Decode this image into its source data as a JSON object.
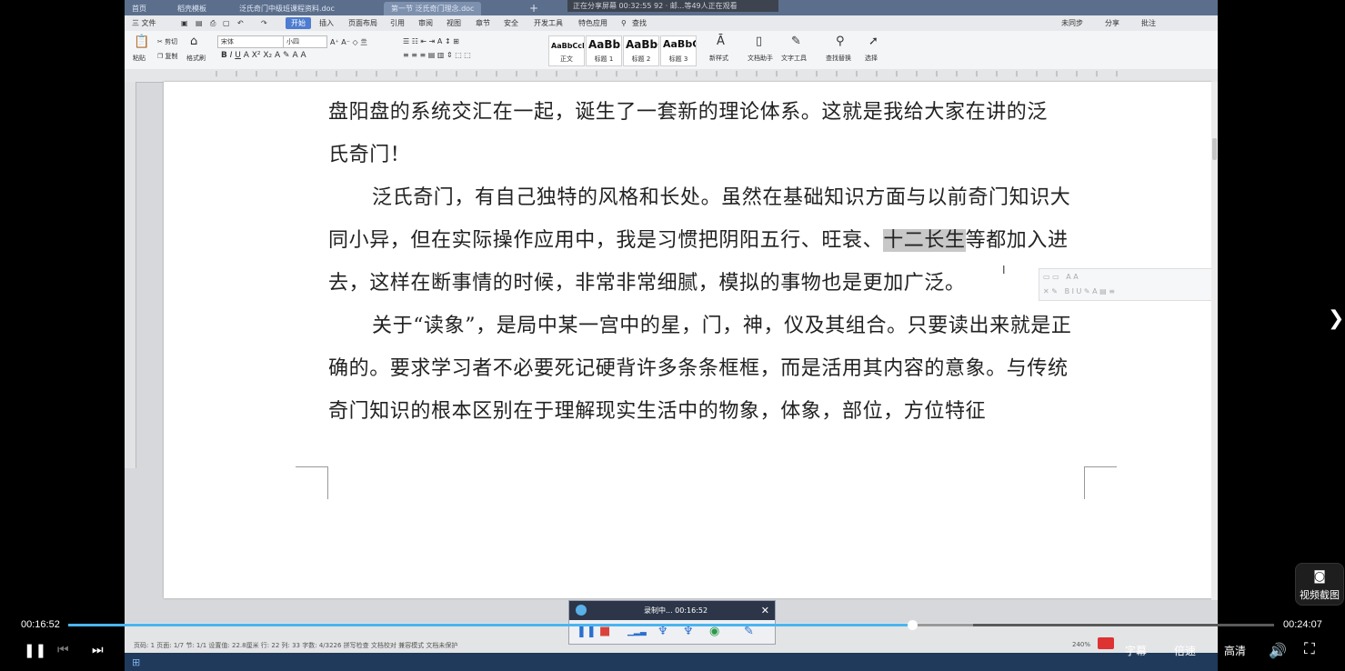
{
  "doc_tabs": [
    "首页",
    "稻壳模板",
    "泛氏奇门中级班课程资料.doc",
    "第一节 泛氏奇门理念.doc"
  ],
  "share_status": "正在分享屏幕    00:32:55    92 · 邮...等49人正在观看",
  "menu": {
    "file": "三 文件",
    "items": [
      "开始",
      "插入",
      "页面布局",
      "引用",
      "审阅",
      "视图",
      "章节",
      "安全",
      "开发工具",
      "特色应用"
    ],
    "search": "查找",
    "right": [
      "未同步",
      "分享",
      "批注"
    ]
  },
  "ribbon": {
    "paste": "粘贴",
    "cut": "剪切",
    "copy": "复制",
    "format_painter": "格式刷",
    "font_name": "宋体",
    "font_size": "小四",
    "styles": [
      {
        "sample": "AaBbCcDd",
        "name": "正文"
      },
      {
        "sample": "AaBb",
        "name": "标题 1"
      },
      {
        "sample": "AaBbC",
        "name": "标题 2"
      },
      {
        "sample": "AaBbC",
        "name": "标题 3"
      }
    ],
    "new_style": "新样式",
    "doc_assistant": "文档助手",
    "text_tools": "文字工具",
    "find_replace": "查找替换",
    "select": "选择"
  },
  "document": {
    "line1": "盘阳盘的系统交汇在一起，诞生了一套新的理论体系。这就是我给大家在讲的泛",
    "line2": "氏奇门！",
    "p2_before": "泛氏奇门，有自己独特的风格和长处。虽然在基础知识方面与以前奇门知识大同小异，但在实际操作应用中，我是习惯把阴阳五行、旺衰、",
    "p2_highlight": "十二长生",
    "p2_after": "等都加入进去，这样在断事情的时候，非常非常细腻，模拟的事物也是更加广泛。",
    "p3": "关于“读象”，是局中某一宫中的星，门，神，仪及其组合。只要读出来就是正确的。要求学习者不必要死记硬背许多条条框框，而是活用其内容的意象。与传统奇门知识的根本区别在于理解现实生活中的物象，体象，部位，方位特征"
  },
  "recorder": {
    "title": "录制中... 00:16:52"
  },
  "statusbar": {
    "left": "页码: 1  页面: 1/7  节: 1/1  设置值: 22.8厘米  行: 22  列: 33  字数: 4/3226  拼写检查  文档校对  兼容模式  文档未保护",
    "zoom": "240%"
  },
  "player": {
    "current_time": "00:16:52",
    "total_time": "00:24:07",
    "progress": 0.7,
    "buffered": 0.75,
    "subtitle": "字幕",
    "speed": "倍速",
    "quality": "高清",
    "snapshot": "视频截图"
  }
}
